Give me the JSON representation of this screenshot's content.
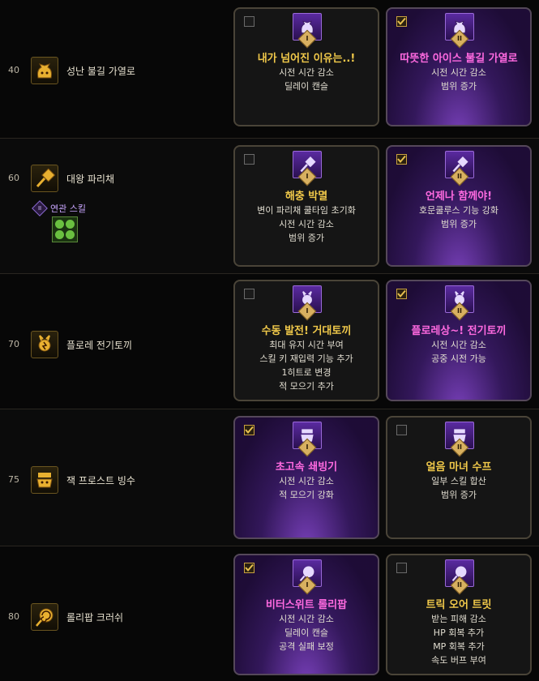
{
  "rows": [
    {
      "level": "40",
      "skill_name": "성난 불길 가열로",
      "options": [
        {
          "selected": false,
          "grade": "I",
          "title": "내가 넘어진 이유는..!",
          "lines": [
            "시전 시간 감소",
            "딜레이 캔슬"
          ]
        },
        {
          "selected": true,
          "grade": "II",
          "title": "따뜻한 아이스 불길 가열로",
          "lines": [
            "시전 시간 감소",
            "범위 증가"
          ]
        }
      ]
    },
    {
      "level": "60",
      "skill_name": "대왕 파리채",
      "related_label": "연관 스킬",
      "related_grade": "II",
      "options": [
        {
          "selected": false,
          "grade": "I",
          "title": "해충 박멸",
          "lines": [
            "변이 파리채 쿨타임 초기화",
            "시전 시간 감소",
            "범위 증가"
          ]
        },
        {
          "selected": true,
          "grade": "II",
          "title": "언제나 함께야!",
          "lines": [
            "호문쿨루스 기능 강화",
            "범위 증가"
          ]
        }
      ]
    },
    {
      "level": "70",
      "skill_name": "플로레 전기토끼",
      "options": [
        {
          "selected": false,
          "grade": "I",
          "title": "수동 발전! 거대토끼",
          "lines": [
            "최대 유지 시간 부여",
            "스킬 키 재입력 기능 추가",
            "1히트로 변경",
            "적 모으기 추가"
          ]
        },
        {
          "selected": true,
          "grade": "II",
          "title": "플로레상~! 전기토끼",
          "lines": [
            "시전 시간 감소",
            "공중 시전 가능"
          ]
        }
      ]
    },
    {
      "level": "75",
      "skill_name": "잭 프로스트 빙수",
      "options": [
        {
          "selected": true,
          "grade": "I",
          "title": "초고속 쇄빙기",
          "lines": [
            "시전 시간 감소",
            "적 모으기 강화"
          ]
        },
        {
          "selected": false,
          "grade": "II",
          "title": "얼음 마녀 수프",
          "lines": [
            "일부 스킬 합산",
            "범위 증가"
          ]
        }
      ]
    },
    {
      "level": "80",
      "skill_name": "롤리팝 크러쉬",
      "options": [
        {
          "selected": true,
          "grade": "I",
          "title": "비터스위트 롤리팝",
          "lines": [
            "시전 시간 감소",
            "딜레이 캔슬",
            "공격 실패 보정"
          ]
        },
        {
          "selected": false,
          "grade": "II",
          "title": "트릭 오어 트릿",
          "lines": [
            "받는 피해 감소",
            "HP 회복 추가",
            "MP 회복 추가",
            "속도 버프 부여"
          ]
        }
      ]
    }
  ],
  "icons": {
    "skill_icons": [
      "fire-sack-icon",
      "flyswatter-icon",
      "electric-rabbit-icon",
      "frost-jack-icon",
      "lollipop-icon"
    ],
    "related_skill_icon": "green-skulls-icon",
    "check_icon": "checkmark-icon"
  },
  "colors": {
    "title_normal": "#f1c94a",
    "title_selected": "#ff6ae0",
    "selected_card_glow": "#8a3ad8"
  }
}
